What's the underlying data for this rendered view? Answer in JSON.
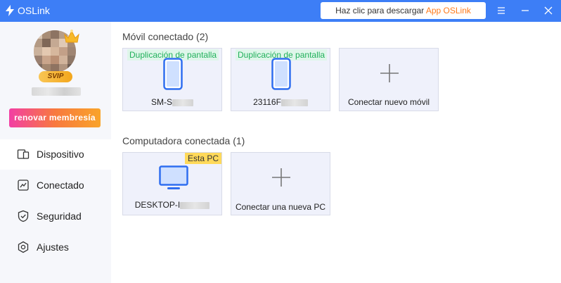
{
  "app": {
    "title": "OSLink"
  },
  "titlebar": {
    "download_prefix": "Haz clic para descargar ",
    "download_link": "App OSLink",
    "brand_color": "#3d7ef6",
    "accent_color": "#ff7a1a"
  },
  "sidebar": {
    "vip_badge": "SVIP",
    "renew_label": "renovar membresía",
    "items": [
      {
        "label": "Dispositivo",
        "icon": "device-icon",
        "active": true
      },
      {
        "label": "Conectado",
        "icon": "chart-icon",
        "active": false
      },
      {
        "label": "Seguridad",
        "icon": "shield-icon",
        "active": false
      },
      {
        "label": "Ajustes",
        "icon": "gear-icon",
        "active": false
      }
    ]
  },
  "main": {
    "mobile_section": {
      "title": "Móvil conectado (2)",
      "devices": [
        {
          "tag": "Duplicación de pantalla",
          "name": "SM-S"
        },
        {
          "tag": "Duplicación de pantalla",
          "name": "23116F"
        }
      ],
      "add_label": "Conectar nuevo móvil"
    },
    "pc_section": {
      "title": "Computadora conectada (1)",
      "devices": [
        {
          "tag": "Esta PC",
          "name": "DESKTOP-I"
        }
      ],
      "add_label": "Conectar una nueva PC"
    }
  }
}
